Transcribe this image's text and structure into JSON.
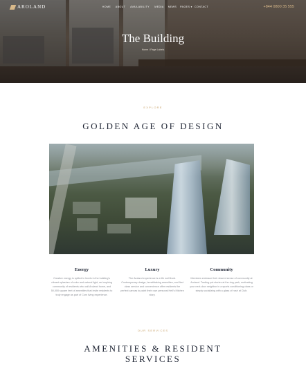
{
  "header": {
    "brand": "AROLAND",
    "menu": [
      "HOME",
      "ABOUT",
      "AVAILABILITY",
      "MEDIA",
      "NEWS",
      "PAGES ▾",
      "CONTACT"
    ],
    "phone": "+844 0800 35 555"
  },
  "hero": {
    "title": "The Building",
    "breadcrumb": "Home / Page Labels"
  },
  "section1": {
    "overline": "EXPLORE",
    "title": "GOLDEN AGE OF DESIGN"
  },
  "features": [
    {
      "title": "Energy",
      "text": "Creative energy is spilled in levels in the building's vibrant splashes of color and natural light, an inspiring community of residents who call Aroland home, and 50,000 square feet of amenities that invite residents to truly engage as part of Com living experience."
    },
    {
      "title": "Luxury",
      "text": "The Aroland experience is a life well lived. Contemporary design, breathtaking amenities, and first class service and convenience offer residents the perfect canvas to paint their own personal Hell's Kitchen story."
    },
    {
      "title": "Community",
      "text": "Members embrace their shared sense of community at Aroland. Trading pet stories at the dog park, motivating your next-door neighbor in a sports conditioning class or simply socializing with a glass of rosé at Club."
    }
  ],
  "section2": {
    "overline": "OUR SERVICES",
    "title_line1": "AMENITIES & RESIDENT",
    "title_line2": "SERVICES"
  }
}
